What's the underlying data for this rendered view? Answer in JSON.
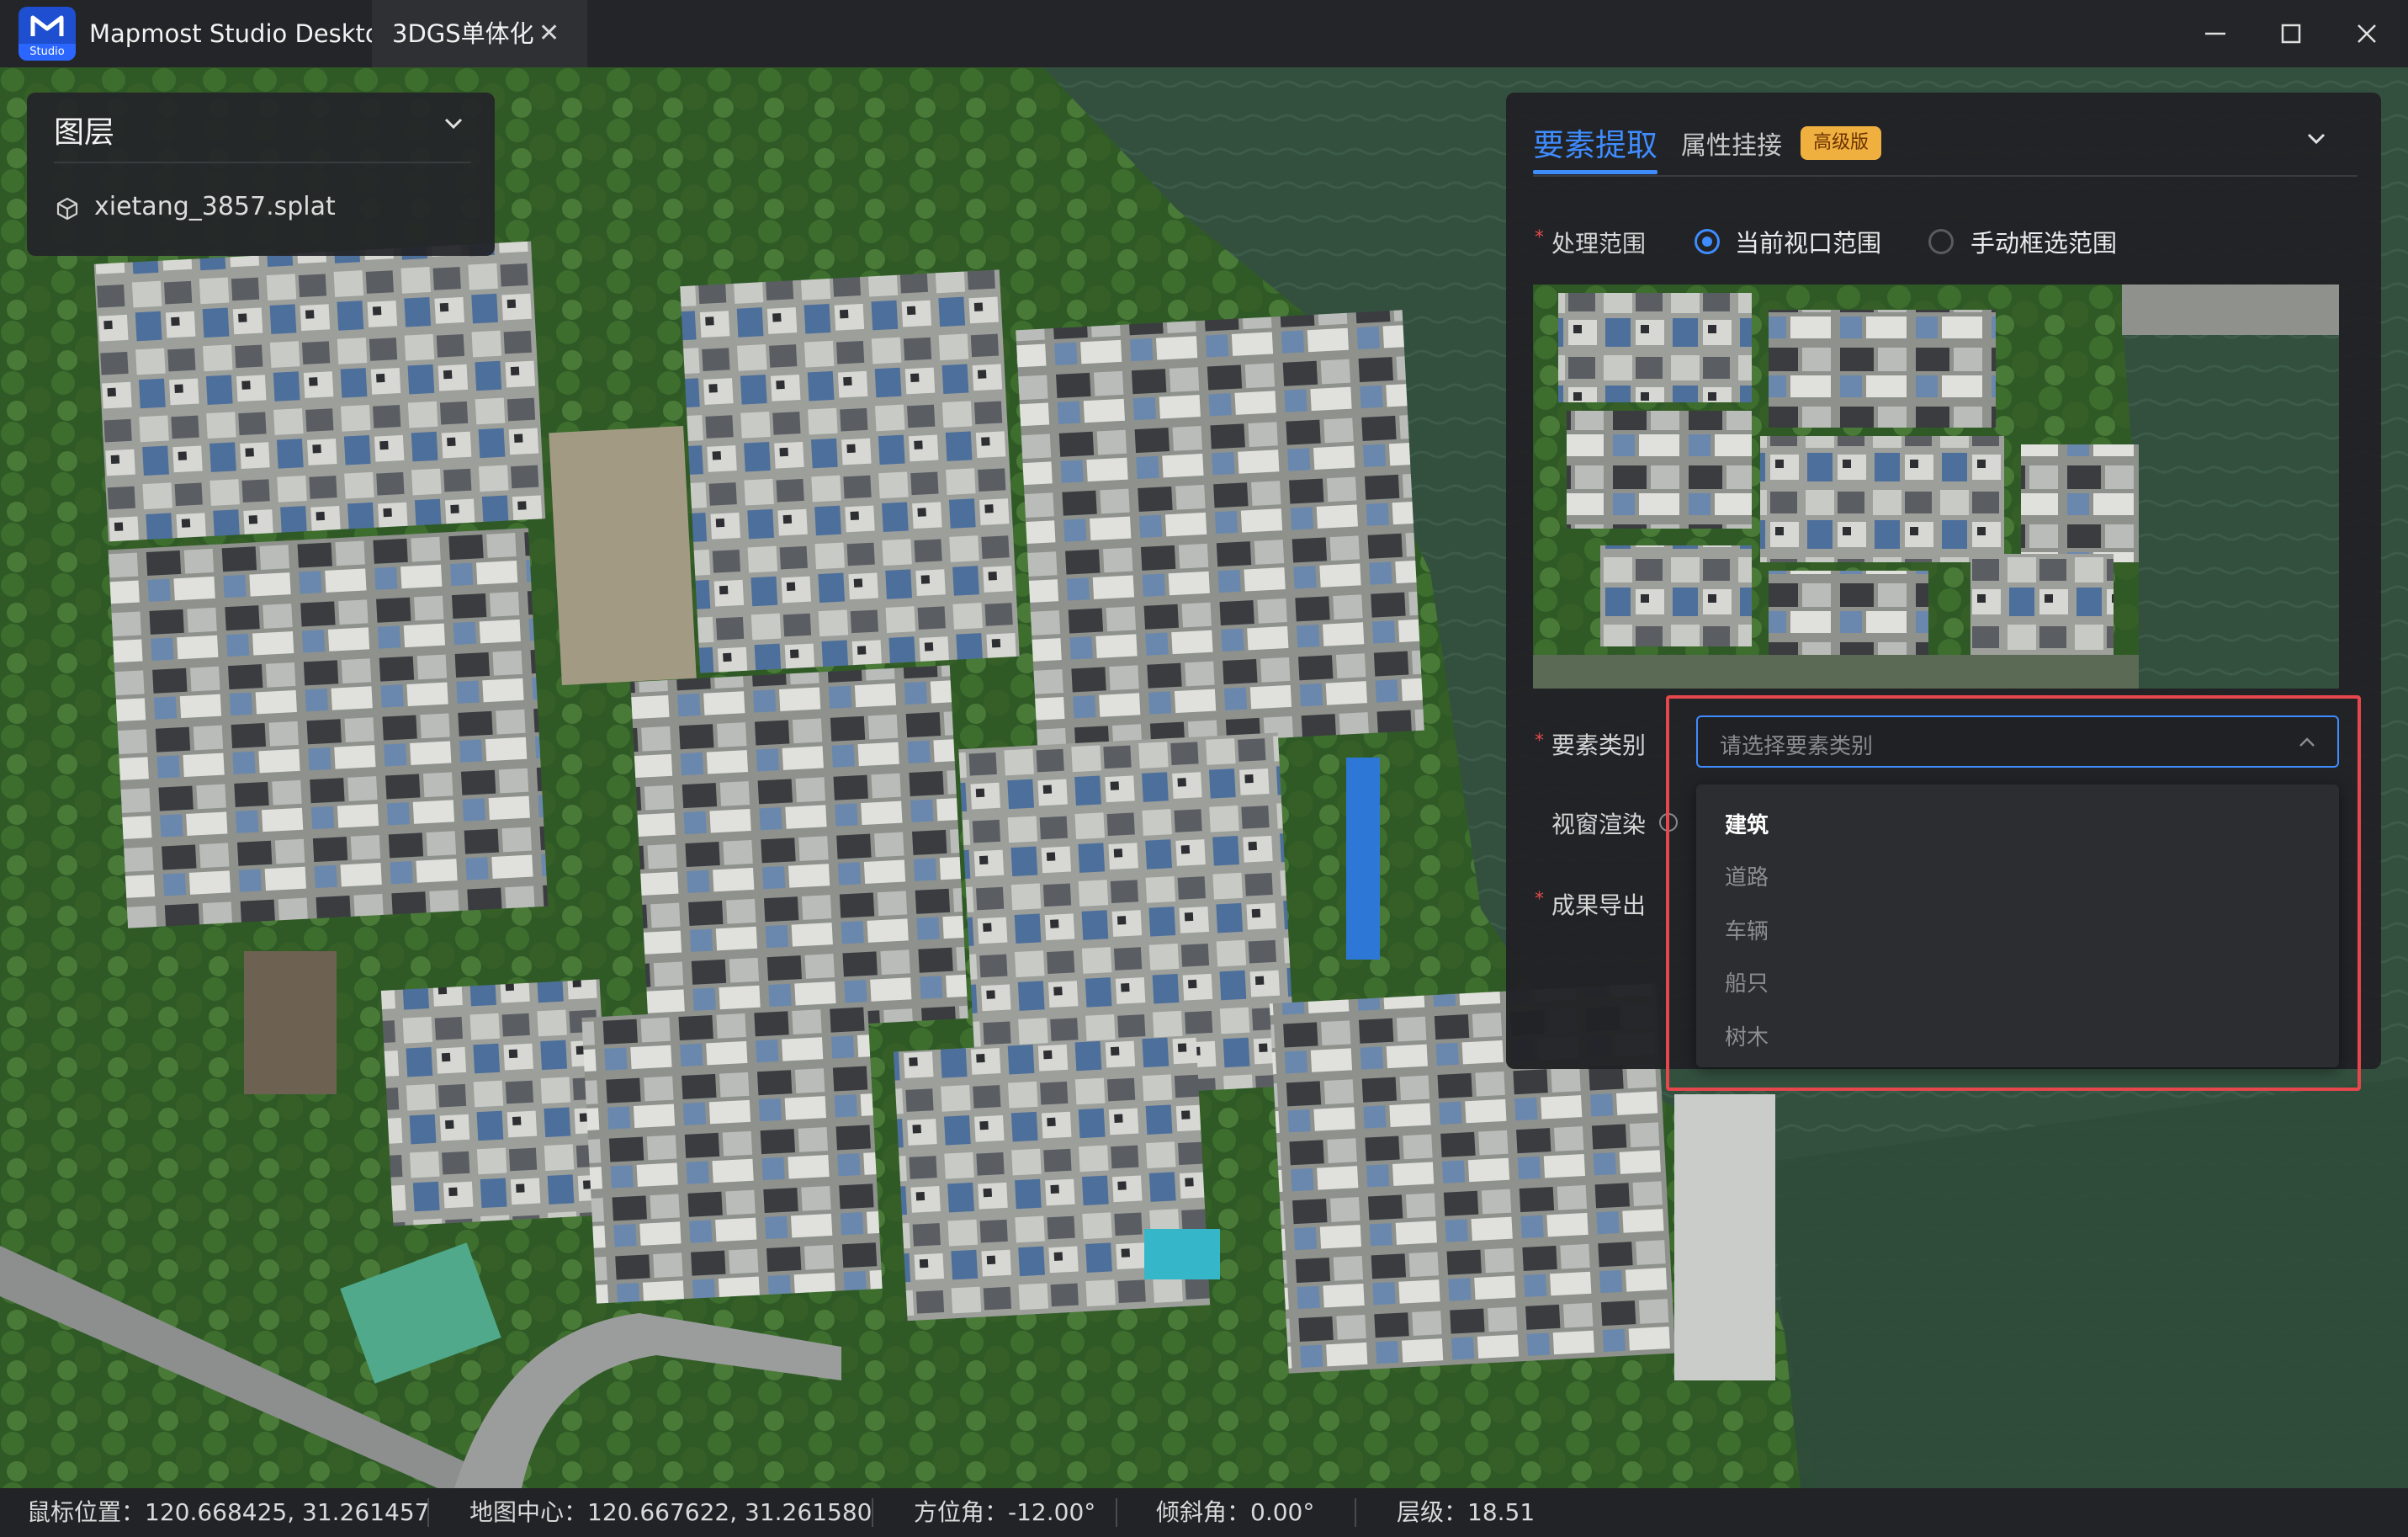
{
  "app": {
    "title": "Mapmost Studio Desktop",
    "logo_tag": "Studio"
  },
  "tabs": [
    {
      "label": "3DGS单体化",
      "close_glyph": "✕"
    }
  ],
  "layers_panel": {
    "title": "图层",
    "items": [
      {
        "name": "xietang_3857.splat",
        "icon": "cube-icon"
      }
    ]
  },
  "right_panel": {
    "tabs": [
      {
        "label": "要素提取",
        "active": true
      },
      {
        "label": "属性挂接",
        "active": false
      }
    ],
    "badge": "高级版",
    "form": {
      "range": {
        "label": "处理范围",
        "required_mark": "*",
        "options": [
          {
            "label": "当前视口范围",
            "selected": true
          },
          {
            "label": "手动框选范围",
            "selected": false
          }
        ]
      },
      "category": {
        "label": "要素类别",
        "required_mark": "*",
        "placeholder": "请选择要素类别",
        "options": [
          {
            "label": "建筑",
            "selected": true
          },
          {
            "label": "道路",
            "selected": false
          },
          {
            "label": "车辆",
            "selected": false
          },
          {
            "label": "船只",
            "selected": false
          },
          {
            "label": "树木",
            "selected": false
          }
        ]
      },
      "render": {
        "label": "视窗渲染"
      },
      "export": {
        "label": "成果导出",
        "required_mark": "*"
      }
    }
  },
  "status_bar": {
    "mouse_position": "鼠标位置：120.668425, 31.261457",
    "map_center": "地图中心：120.667622, 31.261580",
    "bearing": "方位角：-12.00°",
    "pitch": "倾斜角：0.00°",
    "zoom": "层级：18.51"
  },
  "colors": {
    "accent": "#3f8cff",
    "highlight_box": "#e5474c",
    "badge": "#f0b040"
  }
}
